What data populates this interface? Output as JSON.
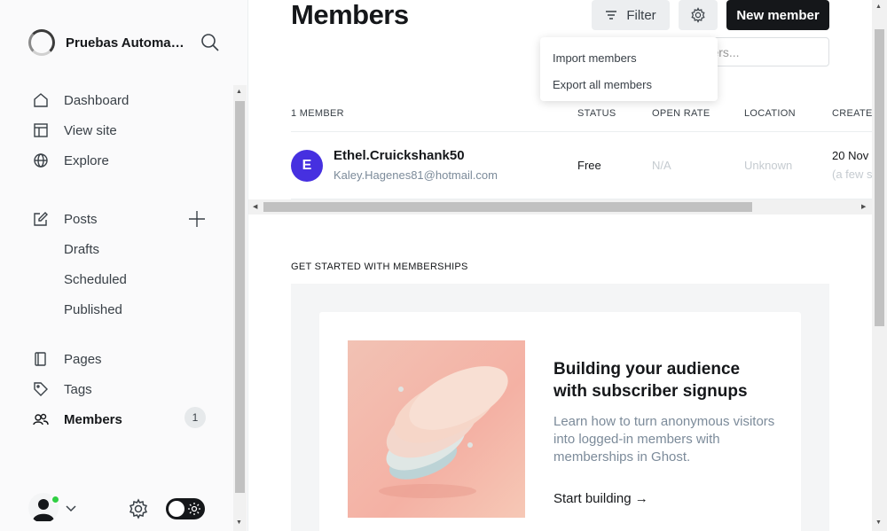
{
  "brand": {
    "name": "Pruebas Automa…"
  },
  "sidebar": {
    "items": [
      {
        "label": "Dashboard",
        "icon": "home-icon"
      },
      {
        "label": "View site",
        "icon": "layout-icon"
      },
      {
        "label": "Explore",
        "icon": "globe-icon"
      },
      {
        "label": "Posts",
        "icon": "edit-icon"
      },
      {
        "label": "Drafts"
      },
      {
        "label": "Scheduled"
      },
      {
        "label": "Published"
      },
      {
        "label": "Pages",
        "icon": "page-icon"
      },
      {
        "label": "Tags",
        "icon": "tag-icon"
      },
      {
        "label": "Members",
        "icon": "users-icon",
        "count": "1"
      }
    ]
  },
  "header": {
    "title": "Members",
    "filter_label": "Filter",
    "new_member_label": "New member",
    "search_value": "mbers..."
  },
  "dropdown": {
    "items": [
      "Import members",
      "Export all members"
    ]
  },
  "table": {
    "columns": [
      "1 MEMBER",
      "STATUS",
      "OPEN RATE",
      "LOCATION",
      "CREATED"
    ],
    "rows": [
      {
        "initial": "E",
        "name": "Ethel.Cruickshank50",
        "email": "Kaley.Hagenes81@hotmail.com",
        "status": "Free",
        "open_rate": "N/A",
        "location": "Unknown",
        "created": "20 Nov",
        "created_relative": "(a few s"
      }
    ]
  },
  "get_started": {
    "section_title": "GET STARTED WITH MEMBERSHIPS",
    "card_title": "Building your audience with subscriber signups",
    "card_desc": "Learn how to turn anonymous visitors into logged-in members with memberships in Ghost.",
    "card_link": "Start building →"
  },
  "colors": {
    "accent_avatar": "#4630e0",
    "primary_button": "#15171a",
    "online_indicator": "#30cf43"
  }
}
